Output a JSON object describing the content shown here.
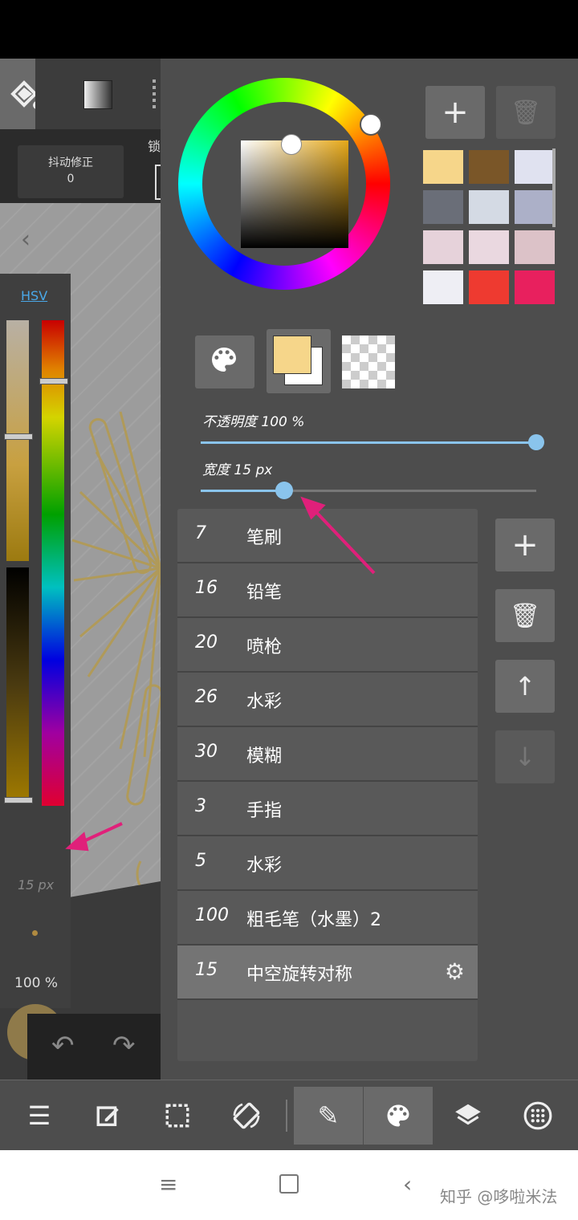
{
  "toolbar": {
    "stabilizer_label": "抖动修正",
    "stabilizer_value": "0",
    "lock_label": "锁"
  },
  "left_panel": {
    "hsv_label": "HSV",
    "size_label": "15 px",
    "opacity_label": "100 %",
    "back_icon": "chevron-left-icon"
  },
  "color": {
    "foreground": "#f6d68a",
    "background": "#ffffff",
    "left_preview": "#8f7a4a"
  },
  "palette": {
    "swatches": [
      "#f6d68a",
      "#7a5628",
      "#e0e2f0",
      "#6a6e78",
      "#d4dae4",
      "#acb0c8",
      "#e6d2da",
      "#ead8e0",
      "#dcc2c8",
      "#eeeef4",
      "#ee3a30",
      "#e8205e"
    ]
  },
  "sliders": {
    "opacity_label": "不透明度 100 %",
    "opacity_value": 1.0,
    "width_label": "宽度 15 px",
    "width_value": 0.25
  },
  "brushes": [
    {
      "size": "7",
      "name": "笔刷"
    },
    {
      "size": "16",
      "name": "铅笔"
    },
    {
      "size": "20",
      "name": "喷枪"
    },
    {
      "size": "26",
      "name": "水彩"
    },
    {
      "size": "30",
      "name": "模糊"
    },
    {
      "size": "3",
      "name": "手指"
    },
    {
      "size": "5",
      "name": "水彩"
    },
    {
      "size": "100",
      "name": "粗毛笔（水墨）2"
    },
    {
      "size": "15",
      "name": "中空旋转对称",
      "selected": true
    }
  ],
  "icons": {
    "add": "+",
    "delete": "trash-icon",
    "up": "arrow-up-icon",
    "down": "arrow-down-icon",
    "gear": "gear-icon"
  },
  "bottom_toolbar": [
    "menu-icon",
    "edit-icon",
    "select-icon",
    "rotate-icon",
    "pen-icon",
    "palette-icon",
    "layers-icon",
    "grid-icon"
  ],
  "navbar": {
    "watermark": "知乎 @哆啦米法"
  },
  "annotation_color": "#e0207a"
}
